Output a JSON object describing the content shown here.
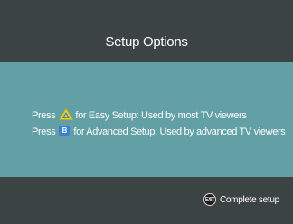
{
  "header": {
    "title": "Setup Options"
  },
  "options": {
    "easy": {
      "prefix": "Press",
      "icon": "yellow-triangle-icon",
      "icon_color": "#f2d21a",
      "text": "for Easy Setup: Used by most TV viewers"
    },
    "advanced": {
      "prefix": "Press",
      "icon": "blue-b-button-icon",
      "icon_label": "B",
      "icon_color": "#3a7fd0",
      "text": "for Advanced Setup: Used by advanced TV viewers"
    }
  },
  "footer": {
    "exit_icon_label": "EXIT",
    "complete_label": "Complete setup"
  },
  "colors": {
    "background": "#3b4442",
    "panel": "#62a0a6",
    "text": "#ffffff"
  }
}
